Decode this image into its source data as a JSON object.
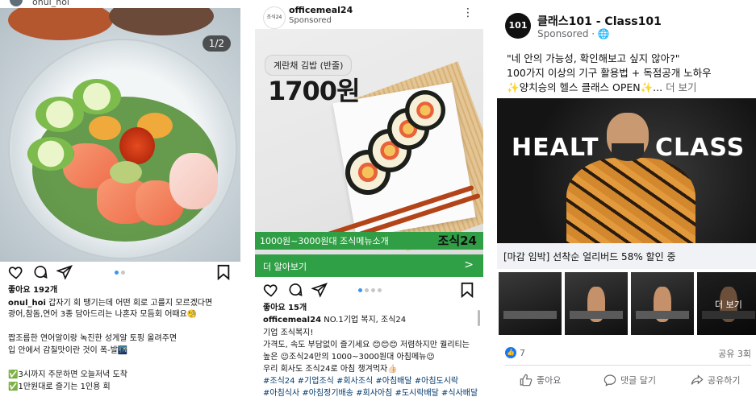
{
  "panel1": {
    "username_top": "onul_hoi",
    "counter": "1/2",
    "likes": "좋아요 192개",
    "caption_user": "onul_hoi",
    "caption_line1": " 갑자기 회 땡기는데 어떤 회로 고를지 모르겠다면",
    "caption_line2": "광어,참돔,연어 3종 담아드리는 나혼자 모듬회 어때요🧐",
    "caption_line3": "짭조름한 연어알이랑 녹진한 성게알 토핑 올려주면",
    "caption_line4": "입 안에서 감칠맛이란 것이 폭-발🌃",
    "caption_line5": "✅3시까지 주문하면 오늘저녁 도착",
    "caption_line6": "✅1만원대로 즐기는 1인용 회"
  },
  "panel2": {
    "account": "officemeal24",
    "sponsored": "Sponsored",
    "logo_text": "조식24",
    "tag": "계란채 김밥 (반줄)",
    "price": "1700원",
    "band_left": "1000원~3000원대 조식메뉴소개",
    "band_right": "조식24",
    "cta": "더 알아보기",
    "cta_arrow": ">",
    "likes": "좋아요 15개",
    "caption_user": "officemeal24",
    "caption_line1": " NO.1기업 복지, 조식24",
    "caption_line2": "기업 조식복지!",
    "caption_line3": "가격도, 속도 부담없이 즐기세요 😊😊😊 저렴하지만 퀄리티는",
    "caption_line4": "높은 😉조식24만의 1000~3000원대 아침메뉴😉",
    "caption_line5": "우리 회사도 조식24로 아침 챙겨먹자👍🏻",
    "hashtags1": "#조식24 #기업조식 #회사조식 #아침배달 #아침도시락",
    "hashtags2": "#아침식사 #아침정기배송 #회사아침 #도시락배달 #식사배달"
  },
  "panel3": {
    "logo_text": "101",
    "page_name": "클래스101 - Class101",
    "sponsored": "Sponsored · ",
    "globe": "🌐",
    "body1": "\"네 안의 가능성, 확인해보고 싶지 않아?\"",
    "body2": "100가지  이상의 기구 활용법 + 독점공개 노하우",
    "body3": "✨양치승의 헬스 클래스 OPEN✨... ",
    "more": "더 보기",
    "hero_word_left": "HEALT",
    "hero_word_right": "CLASS",
    "banner": "[마감 임박] 선착순 얼리버드 58% 할인 중",
    "thumb_more": "더 보기",
    "like_icon": "👍",
    "like_count": "7",
    "share_count": "공유 3회",
    "action_like": "좋아요",
    "action_comment": "댓글 달기",
    "action_share": "공유하기"
  }
}
